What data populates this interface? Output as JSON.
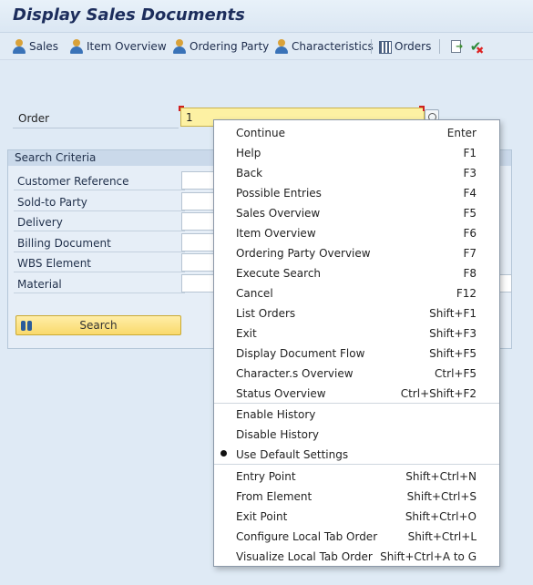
{
  "window": {
    "title": "Display Sales Documents"
  },
  "toolbar": {
    "sales": "Sales",
    "item_overview": "Item Overview",
    "ordering_party": "Ordering Party",
    "characteristics": "Characteristics",
    "orders": "Orders"
  },
  "order": {
    "label": "Order",
    "value": "1"
  },
  "search_criteria": {
    "title": "Search Criteria",
    "fields": [
      "Customer Reference",
      "Sold-to Party",
      "Delivery",
      "Billing Document",
      "WBS Element",
      "Material"
    ],
    "button": "Search"
  },
  "menu": {
    "items": [
      {
        "label": "Continue",
        "shortcut": "Enter"
      },
      {
        "label": "Help",
        "shortcut": "F1"
      },
      {
        "label": "Back",
        "shortcut": "F3"
      },
      {
        "label": "Possible Entries",
        "shortcut": "F4"
      },
      {
        "label": "Sales Overview",
        "shortcut": "F5"
      },
      {
        "label": "Item Overview",
        "shortcut": "F6"
      },
      {
        "label": "Ordering Party Overview",
        "shortcut": "F7"
      },
      {
        "label": "Execute Search",
        "shortcut": "F8"
      },
      {
        "label": "Cancel",
        "shortcut": "F12"
      },
      {
        "label": "List Orders",
        "shortcut": "Shift+F1"
      },
      {
        "label": "Exit",
        "shortcut": "Shift+F3"
      },
      {
        "label": "Display Document Flow",
        "shortcut": "Shift+F5"
      },
      {
        "label": "Character.s Overview",
        "shortcut": "Ctrl+F5"
      },
      {
        "label": "Status Overview",
        "shortcut": "Ctrl+Shift+F2"
      }
    ],
    "history": [
      {
        "label": "Enable History"
      },
      {
        "label": "Disable History"
      },
      {
        "label": "Use Default Settings",
        "selected": true
      }
    ],
    "navigation": [
      {
        "label": "Entry Point",
        "shortcut": "Shift+Ctrl+N"
      },
      {
        "label": "From Element",
        "shortcut": "Shift+Ctrl+S"
      },
      {
        "label": "Exit Point",
        "shortcut": "Shift+Ctrl+O"
      },
      {
        "label": "Configure Local Tab Order",
        "shortcut": "Shift+Ctrl+L"
      },
      {
        "label": "Visualize Local Tab Order",
        "shortcut": "Shift+Ctrl+A to G"
      }
    ]
  }
}
